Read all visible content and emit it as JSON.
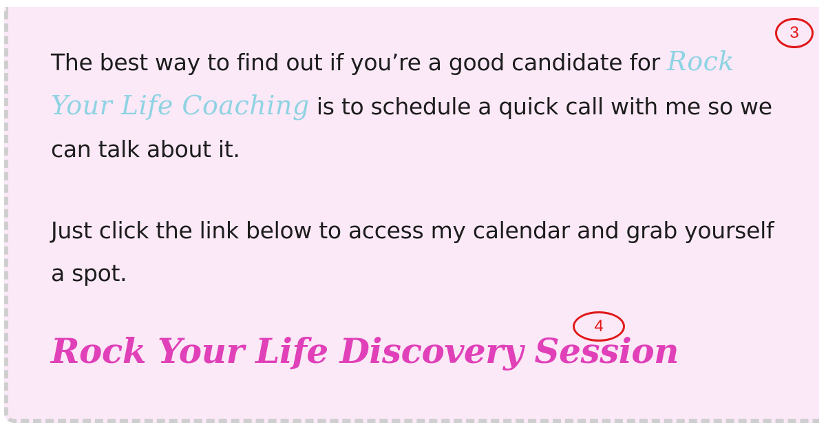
{
  "intro": {
    "line_start": "The best way to find out if you’re a good candidate for ",
    "brand_script": "Rock Your Life  Coaching",
    "line_end": " is to schedule a quick call with me so we can talk about it."
  },
  "instructions": {
    "text": "Just click the link below to access my calendar and grab yourself a spot."
  },
  "link": {
    "label": "Rock Your Life Discovery Session"
  },
  "annotations": {
    "marker_3": "3",
    "marker_4": "4"
  },
  "colors": {
    "card_background": "#fbe9f7",
    "script_accent": "#8fd3e3",
    "link_pink": "#e040b8",
    "marker_red": "#e01818"
  }
}
